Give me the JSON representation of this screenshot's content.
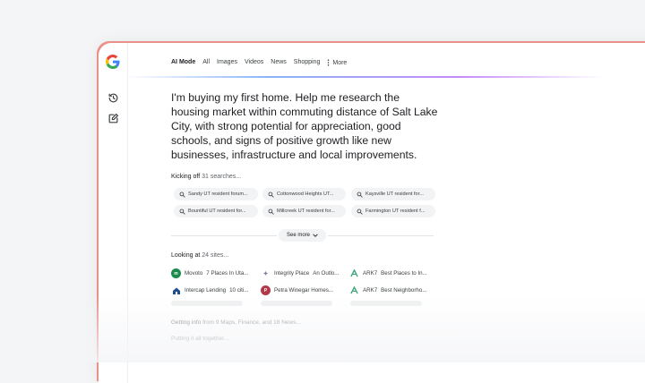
{
  "tabs": [
    "AI Mode",
    "All",
    "Images",
    "Videos",
    "News",
    "Shopping"
  ],
  "more_label": "More",
  "query": "I'm buying my first home. Help me research the housing market within commuting distance of Salt Lake City, with strong potential for appreciation, good schools, and signs of positive growth like new businesses, infrastructure and local improvements.",
  "searches": {
    "prefix": "Kicking off",
    "count": "31 searches...",
    "chips": [
      "Sandy UT resident forum...",
      "Cottonwood Heights UT...",
      "Kaysville UT resident for...",
      "Bountiful UT resident for...",
      "Millcreek UT resident for...",
      "Farmington UT resident f..."
    ]
  },
  "see_more": "See more",
  "sites": {
    "prefix": "Looking at",
    "count": "24 sites...",
    "items": [
      {
        "source": "Movoto",
        "title": "7 Places In Uta...",
        "icon": "movoto-icon",
        "color": "#1b8a4b"
      },
      {
        "source": "Integrity Place",
        "title": "An Outlo...",
        "icon": "integrity-place-icon",
        "color": "#8a7a9a"
      },
      {
        "source": "ARK7",
        "title": "Best Places to In...",
        "icon": "ark7-icon",
        "color": "#3aa57a"
      },
      {
        "source": "Intercap Lending",
        "title": "10 citi...",
        "icon": "intercap-icon",
        "color": "#1f4e8c"
      },
      {
        "source": "Petra Winegar Homes...",
        "title": "",
        "icon": "petra-icon",
        "color": "#b23a48"
      },
      {
        "source": "ARK7",
        "title": "Best Neighborho...",
        "icon": "ark7-icon",
        "color": "#3aa57a"
      }
    ]
  },
  "getting_info": {
    "prefix": "Getting info",
    "rest": "from 9 Maps, Finance, and 18 News..."
  },
  "putting_together": "Putting it all together..."
}
